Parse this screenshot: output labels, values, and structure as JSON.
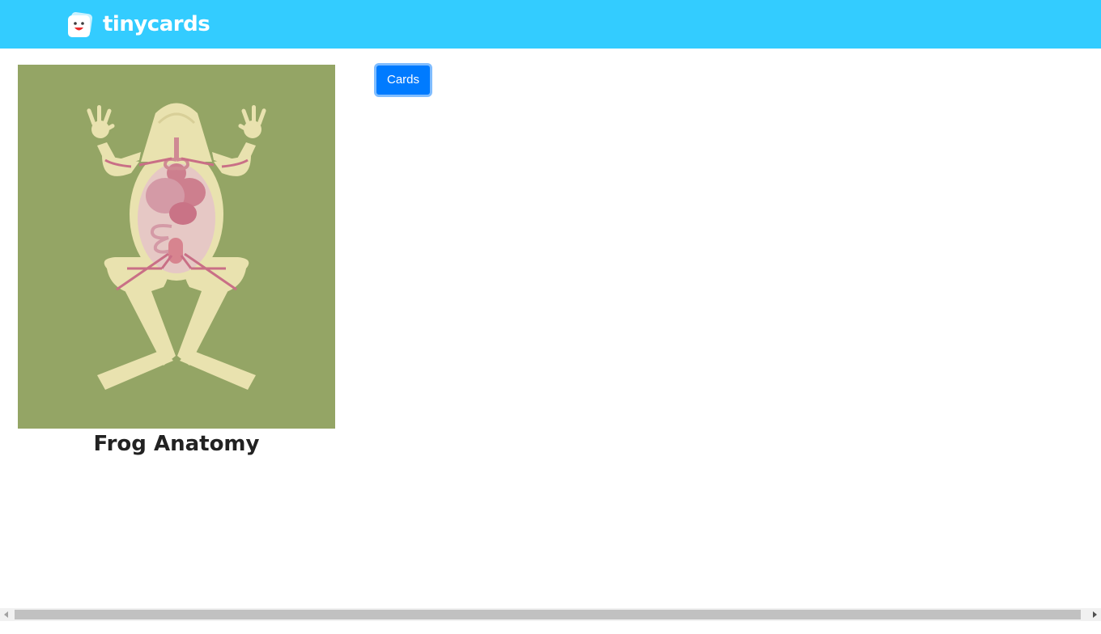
{
  "header": {
    "brand_name": "tinycards",
    "background_color": "#33ccff",
    "logo_icon": "tinycards-logo-icon"
  },
  "deck": {
    "title": "Frog Anatomy",
    "cover_icon": "frog-anatomy-illustration",
    "cover_background": "#94a565"
  },
  "actions": {
    "cards_label": "Cards",
    "accent_color": "#007bff"
  },
  "scrollbar": {
    "left_icon": "scroll-left-arrow-icon",
    "right_icon": "scroll-right-arrow-icon"
  }
}
